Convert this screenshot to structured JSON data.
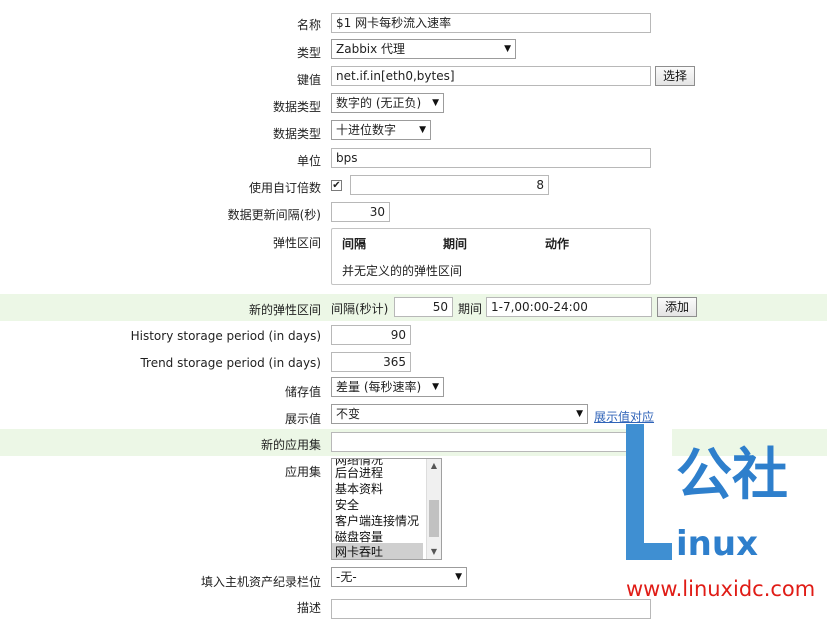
{
  "form": {
    "name": {
      "label": "名称",
      "value": "$1 网卡每秒流入速率"
    },
    "type": {
      "label": "类型",
      "value": "Zabbix 代理"
    },
    "key": {
      "label": "键值",
      "value": "net.if.in[eth0,bytes]",
      "button": "选择"
    },
    "value_type": {
      "label": "数据类型",
      "value": "数字的 (无正负)"
    },
    "data_type": {
      "label": "数据类型",
      "value": "十进位数字"
    },
    "units": {
      "label": "单位",
      "value": "bps"
    },
    "multiplier": {
      "label": "使用自订倍数",
      "checked": true,
      "value": "8"
    },
    "delay": {
      "label": "数据更新间隔(秒)",
      "value": "30"
    },
    "flex_intervals": {
      "label": "弹性区间",
      "headers": [
        "间隔",
        "期间",
        "动作"
      ],
      "empty_text": "并无定义的的弹性区间"
    },
    "new_flex": {
      "label": "新的弹性区间",
      "interval_label": "间隔(秒计)",
      "interval_value": "50",
      "period_label": "期间",
      "period_value": "1-7,00:00-24:00",
      "add_button": "添加"
    },
    "history": {
      "label": "History storage period (in days)",
      "value": "90"
    },
    "trends": {
      "label": "Trend storage period (in days)",
      "value": "365"
    },
    "store_value": {
      "label": "储存值",
      "value": "差量 (每秒速率)"
    },
    "show_value": {
      "label": "展示值",
      "value": "不变",
      "link": "展示值对应"
    },
    "new_application": {
      "label": "新的应用集",
      "value": ""
    },
    "applications": {
      "label": "应用集",
      "items": [
        "网络情况",
        "后台进程",
        "基本资料",
        "安全",
        "客户端连接情况",
        "磁盘容量",
        "网卡吞吐"
      ],
      "selected_index": 6
    },
    "inventory": {
      "label": "填入主机资产纪录栏位",
      "value": "-无-"
    },
    "description": {
      "label": "描述"
    }
  },
  "watermark": {
    "text": "公社",
    "suffix": "inux",
    "url": "www.linuxidc.com"
  },
  "colors": {
    "highlight_row": "#ecf7e6",
    "link": "#2f63b8",
    "watermark_blue": "#2e7fcc",
    "watermark_red": "#e01c16"
  }
}
